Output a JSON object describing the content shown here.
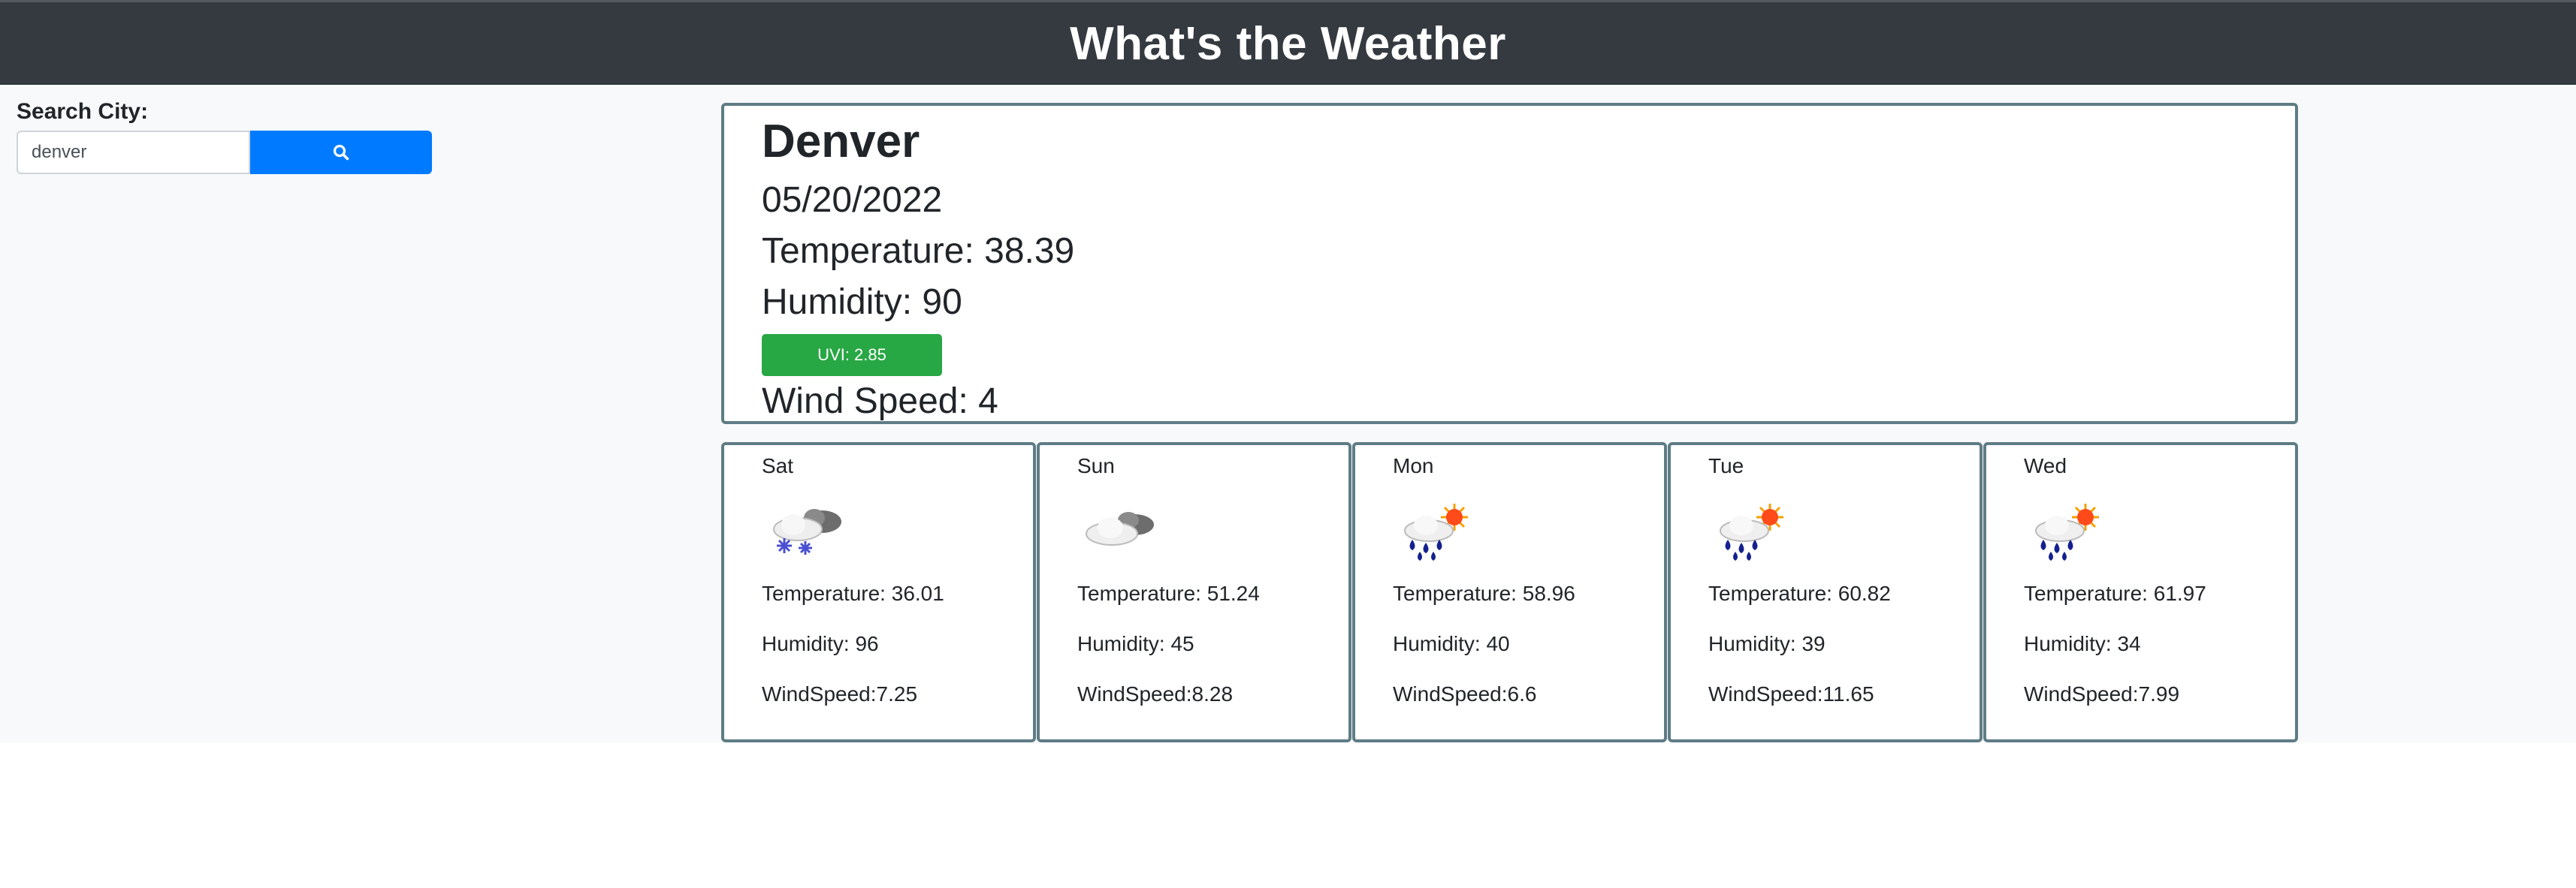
{
  "header": {
    "title": "What's the Weather"
  },
  "search": {
    "label": "Search City:",
    "value": "denver",
    "button_icon": "search-icon"
  },
  "current": {
    "city": "Denver",
    "date": "05/20/2022",
    "temperature": "Temperature: 38.39",
    "humidity": "Humidity: 90",
    "uvi": "UVI: 2.85",
    "uvi_color": "#28a745",
    "wind": "Wind Speed: 4"
  },
  "forecast": [
    {
      "day": "Sat",
      "icon": "snow-cloud-icon",
      "temperature": "Temperature: 36.01",
      "humidity": "Humidity: 96",
      "wind": "WindSpeed:7.25"
    },
    {
      "day": "Sun",
      "icon": "cloud-icon",
      "temperature": "Temperature: 51.24",
      "humidity": "Humidity: 45",
      "wind": "WindSpeed:8.28"
    },
    {
      "day": "Mon",
      "icon": "sun-rain-icon",
      "temperature": "Temperature: 58.96",
      "humidity": "Humidity: 40",
      "wind": "WindSpeed:6.6"
    },
    {
      "day": "Tue",
      "icon": "sun-rain-icon",
      "temperature": "Temperature: 60.82",
      "humidity": "Humidity: 39",
      "wind": "WindSpeed:11.65"
    },
    {
      "day": "Wed",
      "icon": "sun-rain-icon",
      "temperature": "Temperature: 61.97",
      "humidity": "Humidity: 34",
      "wind": "WindSpeed:7.99"
    }
  ],
  "colors": {
    "header_bg": "#343a40",
    "button_bg": "#007bff",
    "card_border": "#5f7c86"
  }
}
